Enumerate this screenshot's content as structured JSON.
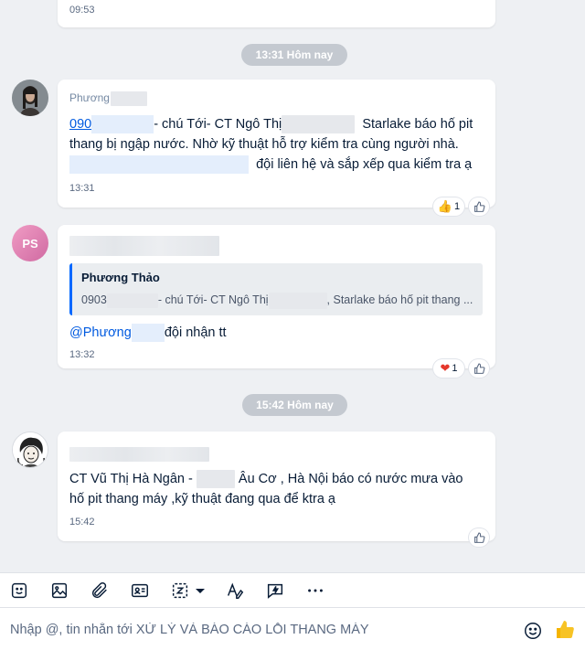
{
  "colors": {
    "accent": "#005ae0",
    "background": "#eef0f3",
    "separator": "#c4c9d0",
    "heart": "#e5372b"
  },
  "top_message": {
    "time": "09:53"
  },
  "separator_1": {
    "label": "13:31 Hôm nay"
  },
  "message_1": {
    "sender": "Phương",
    "phone": "090",
    "text_a": "- chú Tới- CT Ngô Thị",
    "text_b": "Starlake báo hố pit",
    "text_c": "thang bị ngập nước. Nhờ kỹ thuật hỗ trợ kiểm tra cùng người nhà.",
    "text_d": "đội liên hệ và sắp xếp qua kiểm tra ạ",
    "time": "13:31",
    "reaction_icon": "thumbs-up-emoji",
    "reaction_count": "1"
  },
  "message_2": {
    "avatar_initials": "PS",
    "quote_name": "Phương Thảo",
    "quote_text_a": "0903",
    "quote_text_b": "- chú Tới- CT Ngô Thị",
    "quote_text_c": ", Starlake báo hố pit thang ...",
    "mention": "@Phương",
    "text": "đội nhận tt",
    "time": "13:32",
    "reaction_icon": "heart-emoji",
    "reaction_count": "1"
  },
  "separator_2": {
    "label": "15:42 Hôm nay"
  },
  "message_3": {
    "line_1a": "CT Vũ Thị Hà Ngân -",
    "line_1b": "Âu Cơ , Hà Nội báo có nước mưa vào",
    "line_2": "hố pit thang máy ,kỹ thuật đang qua để ktra ạ",
    "time": "15:42"
  },
  "toolbar": {
    "icons": [
      "sticker-icon",
      "image-icon",
      "attachment-icon",
      "contact-card-icon",
      "screenshot-icon",
      "dropdown-caret-icon",
      "text-format-icon",
      "quick-message-icon",
      "more-icon"
    ]
  },
  "composer": {
    "placeholder": "Nhập @, tin nhắn tới XỬ LÝ VÀ BÁO CÁO LỖI THANG MÁY",
    "emoji_icon": "emoji-icon",
    "send_icon": "thumbs-up-send-icon"
  }
}
